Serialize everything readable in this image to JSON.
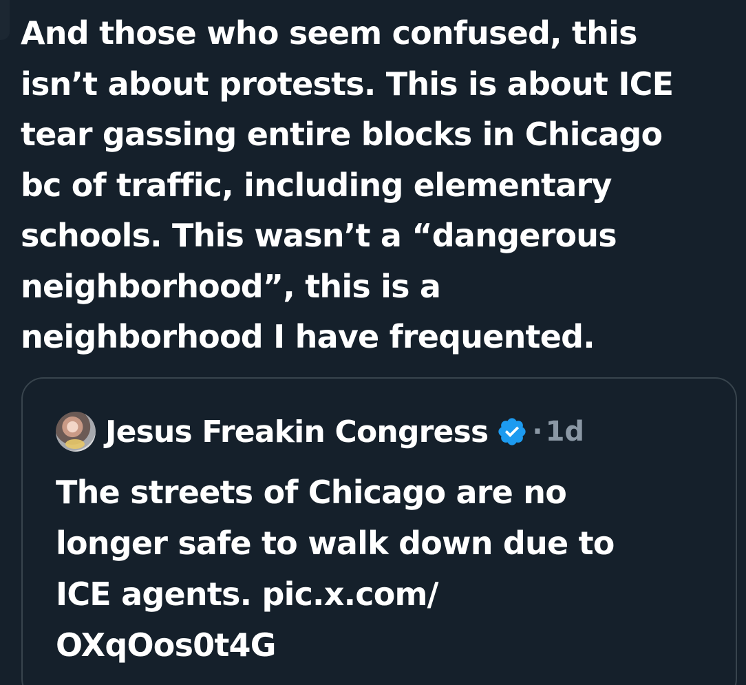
{
  "tweet": {
    "text_lines": [
      "And those who seem confused, this",
      "isn’t about protests. This is about ICE",
      "tear gassing entire blocks in Chicago",
      "bc of traffic, including elementary",
      "schools. This wasn’t a “dangerous",
      "neighborhood”, this is a",
      "neighborhood I have frequented."
    ]
  },
  "quoted_tweet": {
    "author_name": "Jesus Freakin Congress",
    "verified": true,
    "separator": "·",
    "timestamp": "1d",
    "text_lines": [
      "The streets of Chicago are no",
      "longer safe to walk down due to",
      "ICE agents. pic.x.com/",
      "OXqOos0t4G"
    ]
  },
  "icons": {
    "verified": "verified-badge-icon",
    "avatar": "avatar"
  },
  "colors": {
    "background": "#15202b",
    "text": "#ffffff",
    "secondary_text": "#8b98a5",
    "border": "#38444d",
    "verified_blue": "#1d9bf0"
  }
}
